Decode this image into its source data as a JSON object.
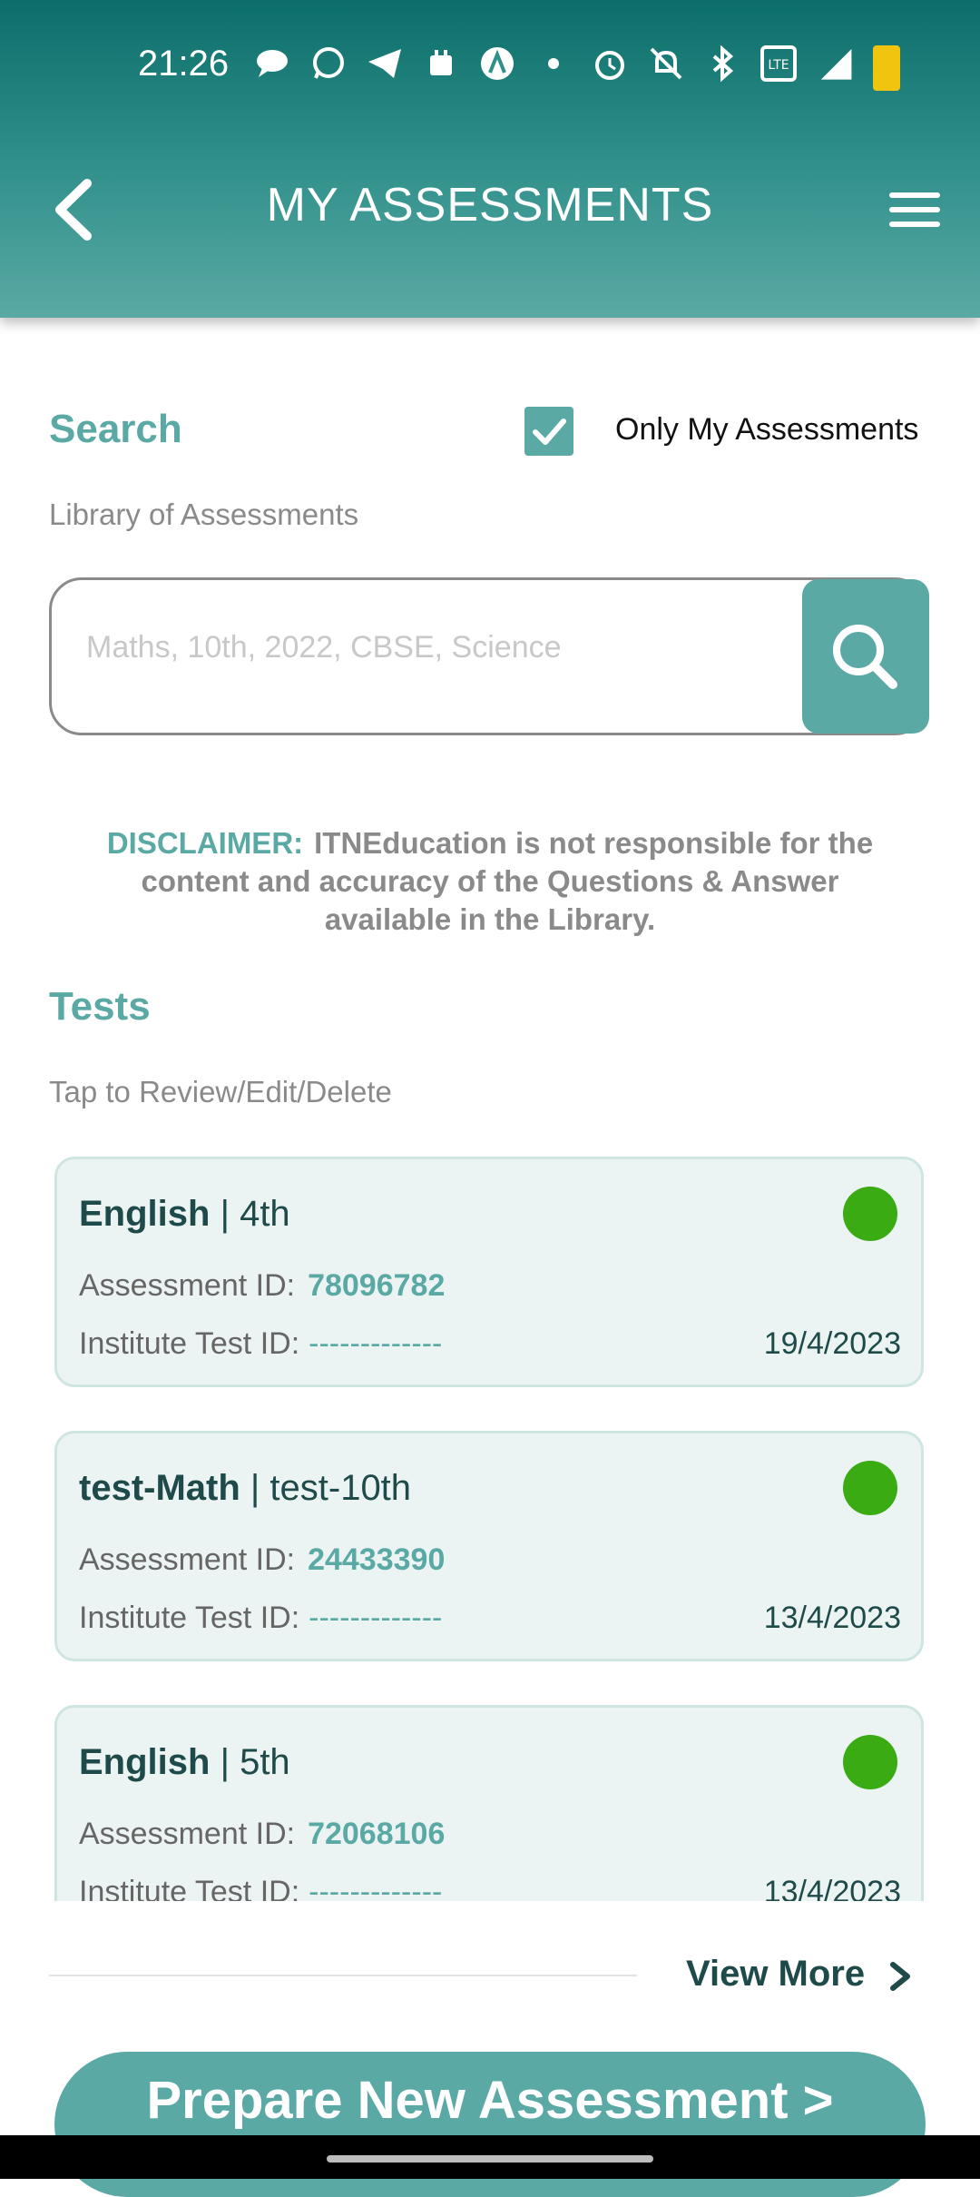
{
  "status_bar": {
    "time": "21:26",
    "icons": [
      "chat-icon",
      "whatsapp-icon",
      "telegram-icon",
      "calendar-icon",
      "app-icon",
      "dot-icon",
      "alarm-icon",
      "mute-icon",
      "bluetooth-icon",
      "volte-icon",
      "signal-4g-icon",
      "battery-icon"
    ],
    "network": "4G+"
  },
  "header": {
    "title": "MY ASSESSMENTS",
    "back_icon": "chevron-left-icon",
    "menu_icon": "hamburger-menu-icon"
  },
  "search": {
    "heading": "Search",
    "only_mine_label": "Only My Assessments",
    "only_mine_checked": true,
    "library_label": "Library of Assessments",
    "placeholder": "Maths, 10th, 2022, CBSE, Science",
    "value": ""
  },
  "disclaimer": {
    "label": "DISCLAIMER:",
    "text": "ITNEducation is not responsible for the content and accuracy of the Questions & Answer available in the Library."
  },
  "tests": {
    "heading": "Tests",
    "hint": "Tap to Review/Edit/Delete",
    "assessment_id_label": "Assessment ID:",
    "institute_id_label": "Institute Test ID:",
    "items": [
      {
        "subject": "English",
        "grade": " | 4th",
        "assessment_id": "78096782",
        "institute_id": "-------------",
        "date": "19/4/2023",
        "status_color": "#3aab12"
      },
      {
        "subject": "test-Math",
        "grade": " | test-10th",
        "assessment_id": "24433390",
        "institute_id": "-------------",
        "date": "13/4/2023",
        "status_color": "#3aab12"
      },
      {
        "subject": "English",
        "grade": " | 5th",
        "assessment_id": "72068106",
        "institute_id": "-------------",
        "date": "13/4/2023",
        "status_color": "#3aab12"
      }
    ]
  },
  "view_more": {
    "label": "View More"
  },
  "prepare": {
    "label": "Prepare New Assessment >"
  },
  "colors": {
    "primary": "#5aa9a4",
    "header_dark": "#0c6e6a",
    "status_green": "#3aab12",
    "card_bg": "#ebf4f3"
  }
}
